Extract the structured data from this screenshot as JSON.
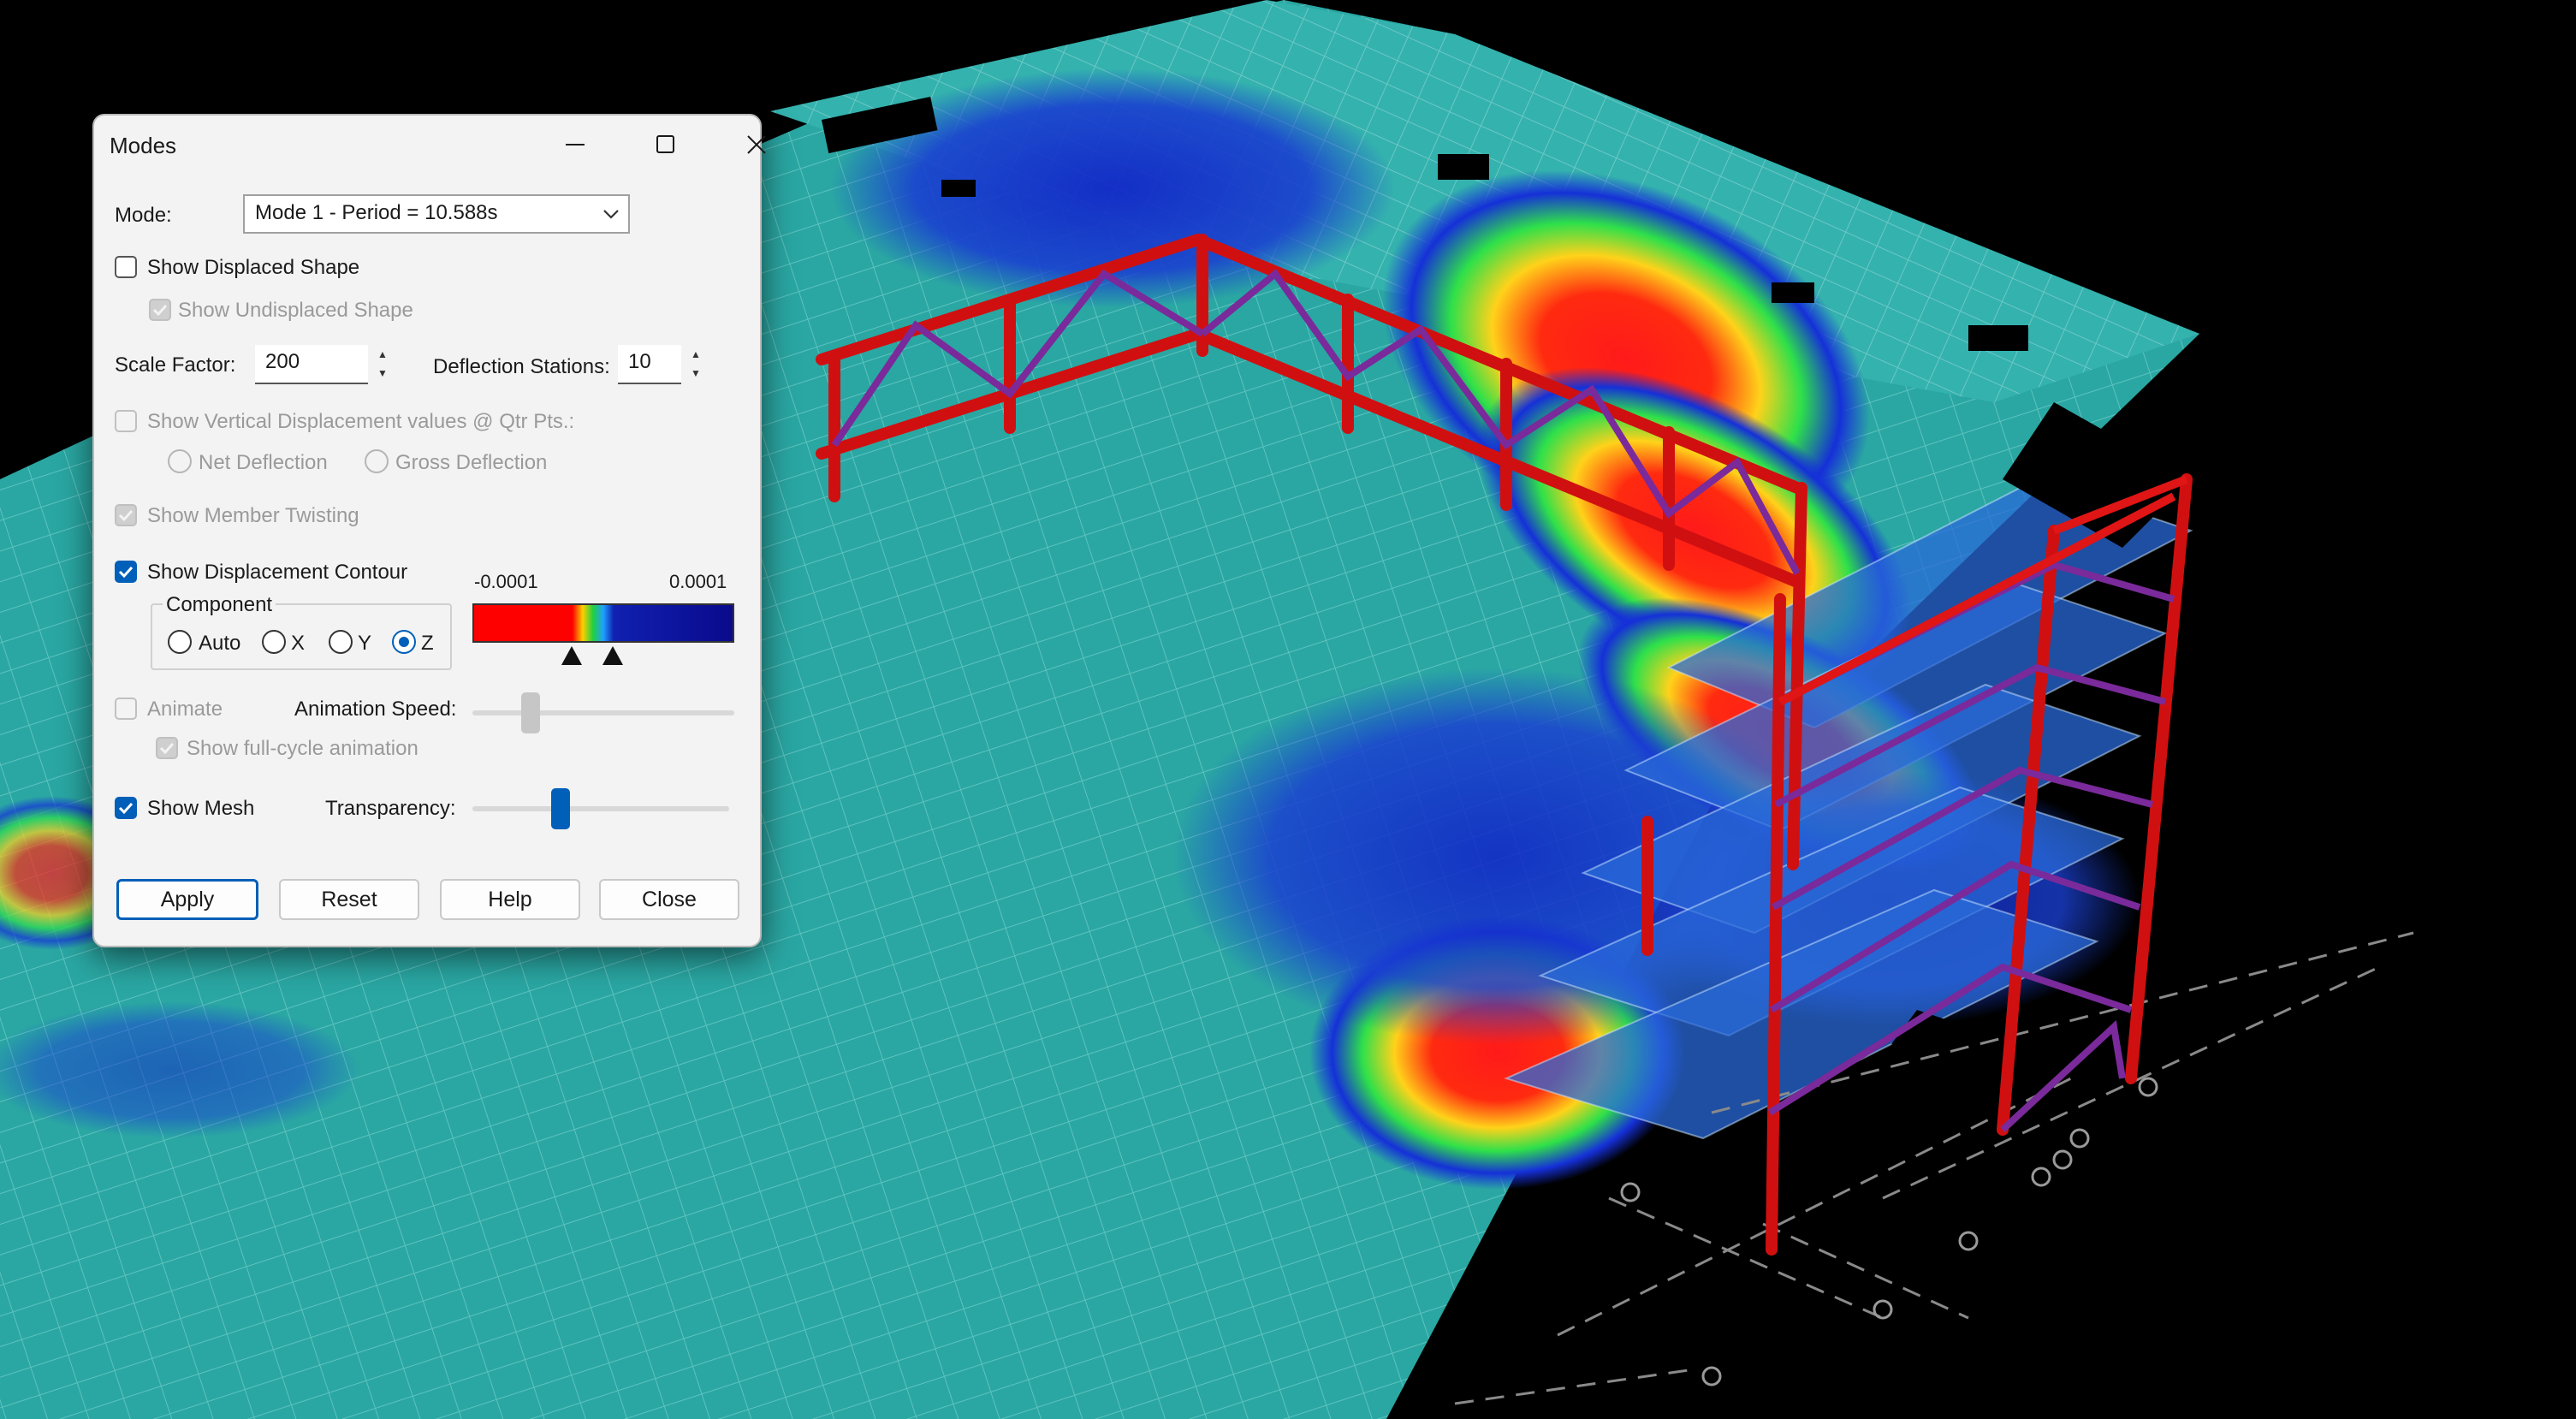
{
  "dialog": {
    "title": "Modes",
    "mode_label": "Mode:",
    "mode_value": "Mode 1 - Period = 10.588s",
    "show_displaced_shape": "Show Displaced Shape",
    "show_undisplaced_shape": "Show Undisplaced Shape",
    "scale_factor_label": "Scale Factor:",
    "scale_factor_value": "200",
    "deflection_stations_label": "Deflection Stations:",
    "deflection_stations_value": "10",
    "show_vertical_displacement": "Show Vertical Displacement values @ Qtr Pts.:",
    "net_deflection": "Net Deflection",
    "gross_deflection": "Gross Deflection",
    "show_member_twisting": "Show Member Twisting",
    "show_displacement_contour": "Show Displacement Contour",
    "component_label": "Component",
    "components": [
      "Auto",
      "X",
      "Y",
      "Z"
    ],
    "selected_component": "Z",
    "contour_min": "-0.0001",
    "contour_max": "0.0001",
    "animate": "Animate",
    "animation_speed_label": "Animation Speed:",
    "show_full_cycle": "Show full-cycle animation",
    "show_mesh": "Show Mesh",
    "transparency_label": "Transparency:",
    "transparency_level": 0.33,
    "animation_speed_level": 0.2,
    "buttons": {
      "apply": "Apply",
      "reset": "Reset",
      "help": "Help",
      "close": "Close"
    }
  },
  "colors": {
    "accent": "#005fb8",
    "contour_red": "#ff0000",
    "contour_blue": "#0a0a8c",
    "mesh_teal": "#28a8a6",
    "frame_red": "#d01010",
    "brace_purple": "#7a2a9a"
  }
}
